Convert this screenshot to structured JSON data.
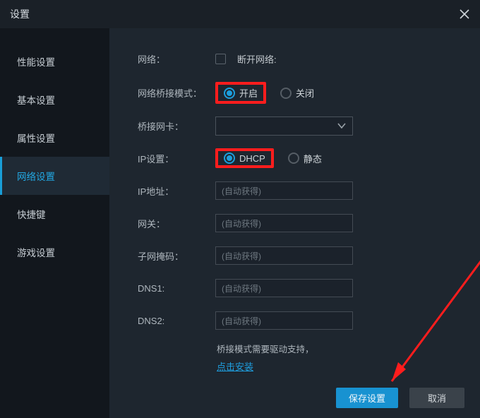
{
  "window": {
    "title": "设置"
  },
  "sidebar": {
    "items": [
      {
        "label": "性能设置"
      },
      {
        "label": "基本设置"
      },
      {
        "label": "属性设置"
      },
      {
        "label": "网络设置"
      },
      {
        "label": "快捷键"
      },
      {
        "label": "游戏设置"
      }
    ],
    "active_index": 3
  },
  "form": {
    "network_label": "网络：",
    "disconnect_label": "断开网络:",
    "disconnect_checked": false,
    "bridge_mode_label": "网络桥接模式：",
    "bridge_on_label": "开启",
    "bridge_off_label": "关闭",
    "bridge_mode": "on",
    "nic_label": "桥接网卡：",
    "nic_value": "",
    "ip_setting_label": "IP设置：",
    "ip_dhcp_label": "DHCP",
    "ip_static_label": "静态",
    "ip_mode": "dhcp",
    "ip_addr_label": "IP地址：",
    "gateway_label": "网关：",
    "subnet_label": "子网掩码：",
    "dns1_label": "DNS1:",
    "dns2_label": "DNS2:",
    "auto_placeholder": "(自动获得)",
    "note_line1": "桥接模式需要驱动支持，",
    "note_link": "点击安装"
  },
  "buttons": {
    "save": "保存设置",
    "cancel": "取消"
  },
  "colors": {
    "accent": "#1c9fdd",
    "highlight": "#ff1d1d",
    "arrow": "#ff1d1d"
  }
}
